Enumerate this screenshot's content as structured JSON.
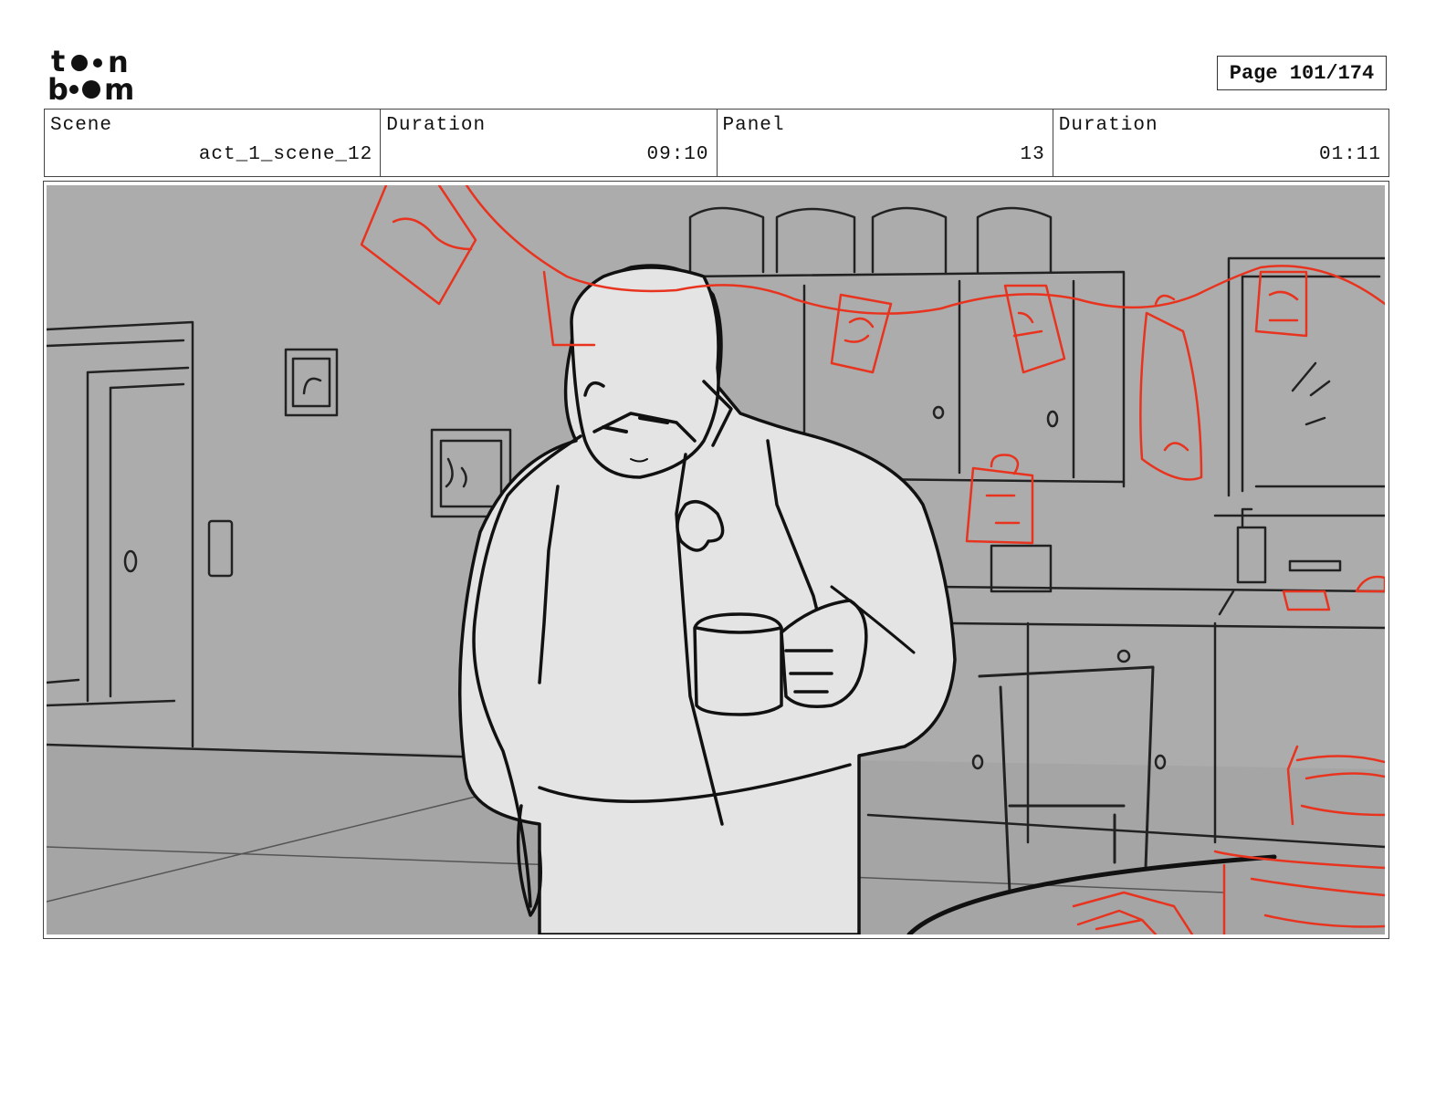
{
  "logo": {
    "brand": "toon boom"
  },
  "page": {
    "label": "Page 101/174"
  },
  "info": {
    "scene_label": "Scene",
    "scene_value": "act_1_scene_12",
    "scene_duration_label": "Duration",
    "scene_duration_value": "09:10",
    "panel_label": "Panel",
    "panel_value": "13",
    "panel_duration_label": "Duration",
    "panel_duration_value": "01:11"
  },
  "colors": {
    "sketch_red": "#e8331f",
    "background_gray": "#a9a9a9",
    "character_fill": "#e4e4e4"
  }
}
